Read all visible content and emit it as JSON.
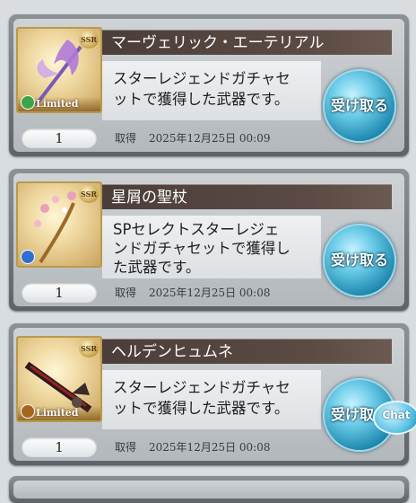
{
  "items": [
    {
      "title": "マーヴェリック・エーテリアル",
      "description_lines": [
        "スターレジェンドガチャセ",
        "ットで獲得した武器です。"
      ],
      "quantity": "1",
      "acquired_label": "取得",
      "acquired_date": "2025年12月25日 00:09",
      "rarity_badge": "SSR",
      "badge_text": "Limited",
      "element_color": "#3fa34a",
      "receive_label": "受け取る"
    },
    {
      "title": "星屑の聖杖",
      "description_lines": [
        "SPセレクトスターレジェ",
        "ンドガチャセットで獲得し",
        "た武器です。"
      ],
      "quantity": "1",
      "acquired_label": "取得",
      "acquired_date": "2025年12月25日 00:08",
      "rarity_badge": "SSR",
      "badge_text": "",
      "element_color": "#2f6fd1",
      "receive_label": "受け取る"
    },
    {
      "title": "ヘルデンヒュムネ",
      "description_lines": [
        "スターレジェンドガチャセ",
        "ットで獲得した武器です。"
      ],
      "quantity": "1",
      "acquired_label": "取得",
      "acquired_date": "2025年12月25日 00:08",
      "rarity_badge": "SSR",
      "badge_text": "Limited",
      "element_color": "#a6651f",
      "receive_label": "受け取る"
    }
  ],
  "chat_button": {
    "label": "Chat"
  }
}
